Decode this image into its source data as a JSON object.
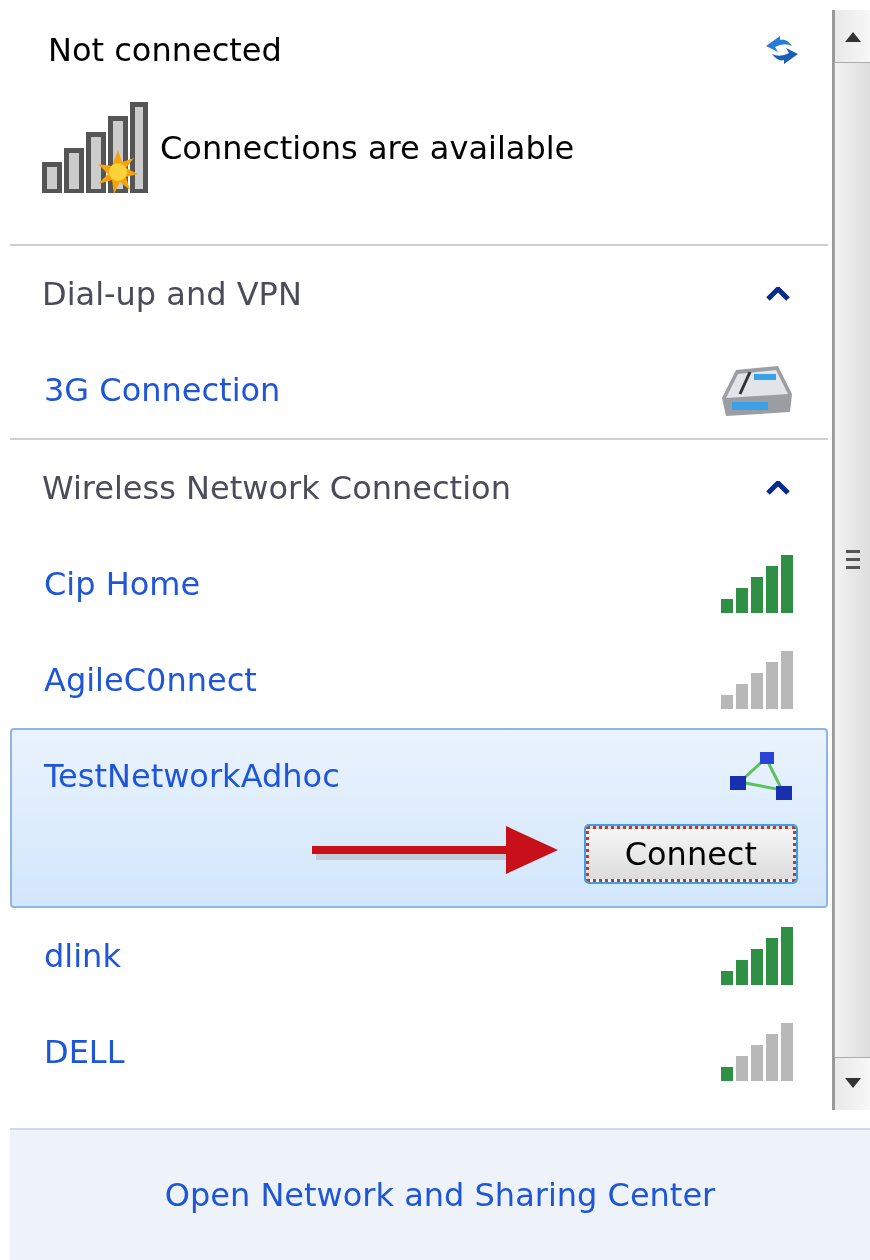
{
  "status": {
    "title": "Not connected",
    "message": "Connections are available"
  },
  "sections": [
    {
      "title": "Dial-up and VPN",
      "expanded": true,
      "items": [
        {
          "kind": "dialup",
          "name": "3G Connection",
          "selected": false
        }
      ]
    },
    {
      "title": "Wireless Network Connection",
      "expanded": true,
      "items": [
        {
          "kind": "strong",
          "name": "Cip Home",
          "selected": false
        },
        {
          "kind": "grey",
          "name": "AgileC0nnect",
          "selected": false
        },
        {
          "kind": "adhoc",
          "name": "TestNetworkAdhoc",
          "selected": true,
          "action": "Connect"
        },
        {
          "kind": "strong",
          "name": "dlink",
          "selected": false
        },
        {
          "kind": "faint",
          "name": "DELL",
          "selected": false
        }
      ]
    }
  ],
  "footer": {
    "link": "Open Network and Sharing Center"
  }
}
